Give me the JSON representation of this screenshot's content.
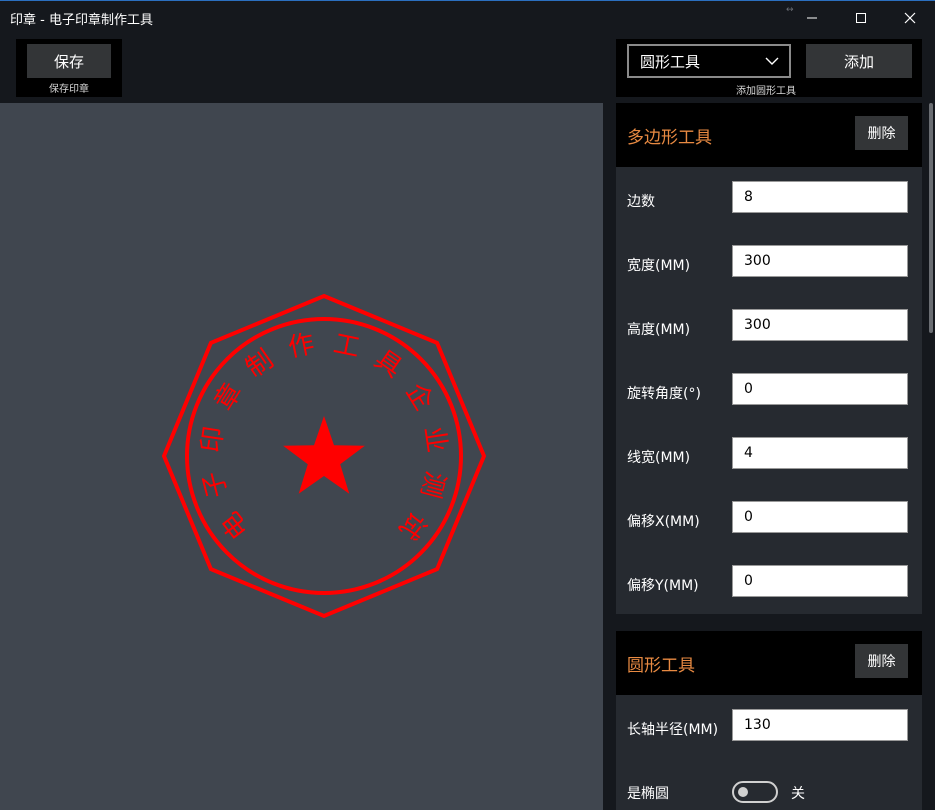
{
  "window": {
    "title": "印章 - 电子印章制作工具"
  },
  "toolbar_left": {
    "save_label": "保存",
    "save_caption": "保存印章"
  },
  "toolbar_right": {
    "shape_select_value": "圆形工具",
    "add_label": "添加",
    "add_caption": "添加圆形工具"
  },
  "seal": {
    "color": "#ff0000",
    "text": "电子印章制作工具企业测试",
    "polygon_sides": 8,
    "star": true
  },
  "panels": {
    "polygon": {
      "title": "多边形工具",
      "delete_label": "删除",
      "fields": [
        {
          "label": "边数",
          "value": "8"
        },
        {
          "label": "宽度(MM)",
          "value": "300"
        },
        {
          "label": "高度(MM)",
          "value": "300"
        },
        {
          "label": "旋转角度(°)",
          "value": "0"
        },
        {
          "label": "线宽(MM)",
          "value": "4"
        },
        {
          "label": "偏移X(MM)",
          "value": "0"
        },
        {
          "label": "偏移Y(MM)",
          "value": "0"
        }
      ]
    },
    "circle": {
      "title": "圆形工具",
      "delete_label": "删除",
      "fields": [
        {
          "label": "长轴半径(MM)",
          "value": "130"
        }
      ],
      "ellipse_label": "是椭圆",
      "ellipse_state": "关"
    }
  },
  "colors": {
    "accent": "#e88a42",
    "canvas_bg": "#40464f",
    "panel_bg": "#262a30"
  }
}
